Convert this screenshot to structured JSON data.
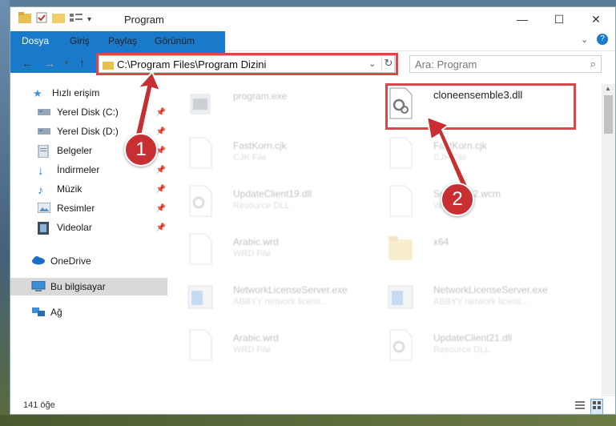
{
  "window": {
    "title": "Program"
  },
  "ribbon": {
    "tabs": [
      "Dosya",
      "Giriş",
      "Paylaş",
      "Görünüm"
    ]
  },
  "address": {
    "path": "C:\\Program Files\\Program Dizini"
  },
  "search": {
    "placeholder": "Ara: Program"
  },
  "sidebar": {
    "items": [
      {
        "label": "Hızlı erişim",
        "icon": "star-icon"
      },
      {
        "label": "Yerel Disk (C:)",
        "icon": "drive-icon"
      },
      {
        "label": "Yerel Disk (D:)",
        "icon": "drive-icon"
      },
      {
        "label": "Belgeler",
        "icon": "documents-icon"
      },
      {
        "label": "İndirmeler",
        "icon": "download-icon"
      },
      {
        "label": "Müzik",
        "icon": "music-icon"
      },
      {
        "label": "Resimler",
        "icon": "pictures-icon"
      },
      {
        "label": "Videolar",
        "icon": "videos-icon"
      },
      {
        "label": "OneDrive",
        "icon": "cloud-icon"
      },
      {
        "label": "Bu bilgisayar",
        "icon": "computer-icon"
      },
      {
        "label": "Ağ",
        "icon": "network-icon"
      }
    ]
  },
  "files": [
    {
      "name": "program.exe",
      "sub": ""
    },
    {
      "name": "cloneensemble3.dll",
      "sub": ""
    },
    {
      "name": "FastKorn.cjk",
      "sub": "CJK File"
    },
    {
      "name": "FastKorn.cjk",
      "sub": "CJK File"
    },
    {
      "name": "UpdateClient19.dll",
      "sub": "Resource DLL"
    },
    {
      "name": "SndRes32.wcm",
      "sub": "WCM File"
    },
    {
      "name": "Arabic.wrd",
      "sub": "WRD File"
    },
    {
      "name": "x64",
      "sub": ""
    },
    {
      "name": "NetworkLicenseServer.exe",
      "sub": "ABBYY network licens..."
    },
    {
      "name": "NetworkLicenseServer.exe",
      "sub": "ABBYY network licens..."
    },
    {
      "name": "Arabic.wrd",
      "sub": "WRD File"
    },
    {
      "name": "UpdateClient21.dll",
      "sub": "Resource DLL"
    }
  ],
  "status": {
    "count": "141 öğe"
  },
  "annotations": {
    "step1": "1",
    "step2": "2"
  },
  "colors": {
    "highlight": "#d9474b",
    "accent": "#1979ca",
    "badge": "#c82f32"
  }
}
